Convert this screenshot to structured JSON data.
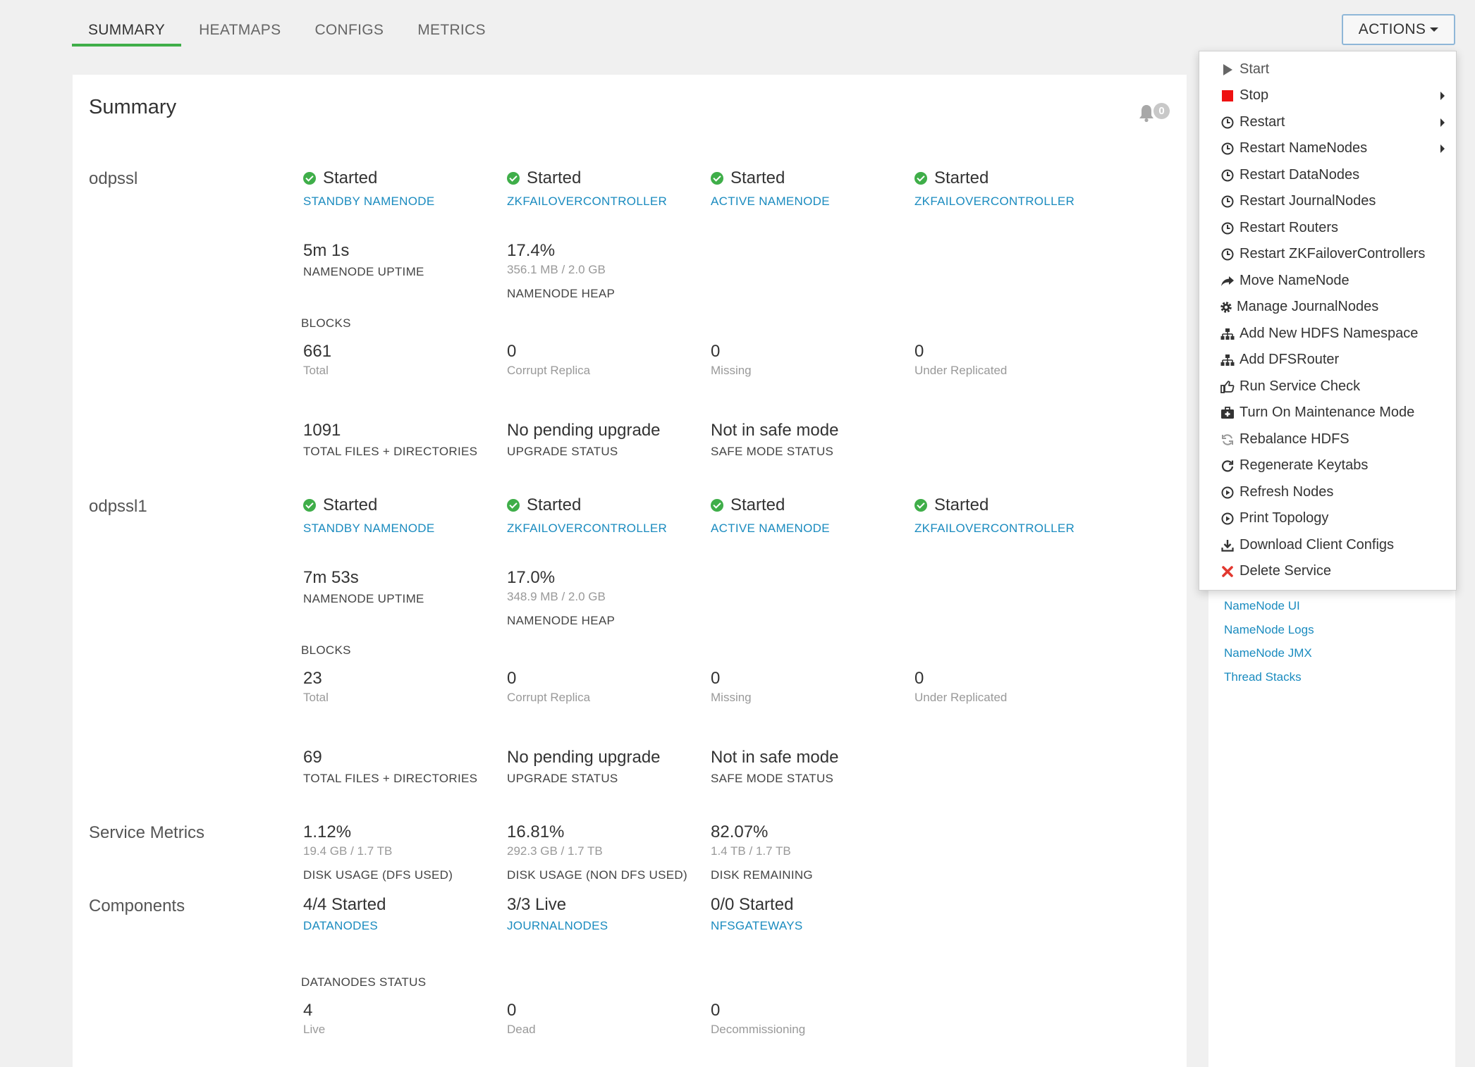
{
  "tabs": [
    "SUMMARY",
    "HEATMAPS",
    "CONFIGS",
    "METRICS"
  ],
  "actions_button": "ACTIONS",
  "summary": {
    "title": "Summary",
    "alert_count": "0",
    "namespaces": [
      {
        "name": "odpssl",
        "components": [
          {
            "status": "Started",
            "name": "STANDBY NAMENODE"
          },
          {
            "status": "Started",
            "name": "ZKFAILOVERCONTROLLER"
          },
          {
            "status": "Started",
            "name": "ACTIVE NAMENODE"
          },
          {
            "status": "Started",
            "name": "ZKFAILOVERCONTROLLER"
          }
        ],
        "uptime": {
          "value": "5m 1s",
          "label": "NAMENODE UPTIME"
        },
        "heap": {
          "value": "17.4%",
          "detail": "356.1 MB / 2.0 GB",
          "label": "NAMENODE HEAP"
        },
        "blocks_label": "BLOCKS",
        "blocks": [
          {
            "value": "661",
            "label": "Total"
          },
          {
            "value": "0",
            "label": "Corrupt Replica"
          },
          {
            "value": "0",
            "label": "Missing"
          },
          {
            "value": "0",
            "label": "Under Replicated"
          }
        ],
        "files": {
          "value": "1091",
          "label": "TOTAL FILES + DIRECTORIES"
        },
        "upgrade": {
          "value": "No pending upgrade",
          "label": "UPGRADE STATUS"
        },
        "safemode": {
          "value": "Not in safe mode",
          "label": "SAFE MODE STATUS"
        }
      },
      {
        "name": "odpssl1",
        "components": [
          {
            "status": "Started",
            "name": "STANDBY NAMENODE"
          },
          {
            "status": "Started",
            "name": "ZKFAILOVERCONTROLLER"
          },
          {
            "status": "Started",
            "name": "ACTIVE NAMENODE"
          },
          {
            "status": "Started",
            "name": "ZKFAILOVERCONTROLLER"
          }
        ],
        "uptime": {
          "value": "7m 53s",
          "label": "NAMENODE UPTIME"
        },
        "heap": {
          "value": "17.0%",
          "detail": "348.9 MB / 2.0 GB",
          "label": "NAMENODE HEAP"
        },
        "blocks_label": "BLOCKS",
        "blocks": [
          {
            "value": "23",
            "label": "Total"
          },
          {
            "value": "0",
            "label": "Corrupt Replica"
          },
          {
            "value": "0",
            "label": "Missing"
          },
          {
            "value": "0",
            "label": "Under Replicated"
          }
        ],
        "files": {
          "value": "69",
          "label": "TOTAL FILES + DIRECTORIES"
        },
        "upgrade": {
          "value": "No pending upgrade",
          "label": "UPGRADE STATUS"
        },
        "safemode": {
          "value": "Not in safe mode",
          "label": "SAFE MODE STATUS"
        }
      }
    ],
    "service_metrics": {
      "label": "Service Metrics",
      "items": [
        {
          "value": "1.12%",
          "detail": "19.4 GB / 1.7 TB",
          "label": "DISK USAGE (DFS USED)"
        },
        {
          "value": "16.81%",
          "detail": "292.3 GB / 1.7 TB",
          "label": "DISK USAGE (NON DFS USED)"
        },
        {
          "value": "82.07%",
          "detail": "1.4 TB / 1.7 TB",
          "label": "DISK REMAINING"
        }
      ]
    },
    "components": {
      "label": "Components",
      "items": [
        {
          "value": "4/4 Started",
          "link": "DATANODES"
        },
        {
          "value": "3/3 Live",
          "link": "JOURNALNODES"
        },
        {
          "value": "0/0 Started",
          "link": "NFSGATEWAYS"
        }
      ]
    },
    "datanodes_status": {
      "label": "DATANODES STATUS",
      "items": [
        {
          "value": "4",
          "label": "Live"
        },
        {
          "value": "0",
          "label": "Dead"
        },
        {
          "value": "0",
          "label": "Decommissioning"
        }
      ]
    }
  },
  "actions_menu": [
    {
      "label": "Start",
      "icon": "play-icon"
    },
    {
      "label": "Stop",
      "icon": "stop-icon",
      "submenu": true
    },
    {
      "label": "Restart",
      "icon": "clock-icon",
      "submenu": true
    },
    {
      "label": "Restart NameNodes",
      "icon": "clock-icon",
      "submenu": true
    },
    {
      "label": "Restart DataNodes",
      "icon": "clock-icon"
    },
    {
      "label": "Restart JournalNodes",
      "icon": "clock-icon"
    },
    {
      "label": "Restart Routers",
      "icon": "clock-icon"
    },
    {
      "label": "Restart ZKFailoverControllers",
      "icon": "clock-icon"
    },
    {
      "label": "Move NameNode",
      "icon": "share-arrow-icon"
    },
    {
      "label": "Manage JournalNodes",
      "icon": "gear-icon"
    },
    {
      "label": "Add New HDFS Namespace",
      "icon": "sitemap-icon"
    },
    {
      "label": "Add DFSRouter",
      "icon": "sitemap-icon"
    },
    {
      "label": "Run Service Check",
      "icon": "thumbs-up-icon"
    },
    {
      "label": "Turn On Maintenance Mode",
      "icon": "medkit-icon"
    },
    {
      "label": "Rebalance HDFS",
      "icon": "refresh-icon"
    },
    {
      "label": "Regenerate Keytabs",
      "icon": "redo-icon"
    },
    {
      "label": "Refresh Nodes",
      "icon": "play-circle-icon"
    },
    {
      "label": "Print Topology",
      "icon": "play-circle-icon"
    },
    {
      "label": "Download Client Configs",
      "icon": "download-icon"
    },
    {
      "label": "Delete Service",
      "icon": "close-icon"
    }
  ],
  "quick_links": [
    "NameNode UI",
    "NameNode Logs",
    "NameNode JMX",
    "Thread Stacks"
  ],
  "colors": {
    "accent_green": "#3fae49",
    "link_blue": "#1a8bbf",
    "stop_red": "#ee1111",
    "delete_red": "#e2382f"
  }
}
